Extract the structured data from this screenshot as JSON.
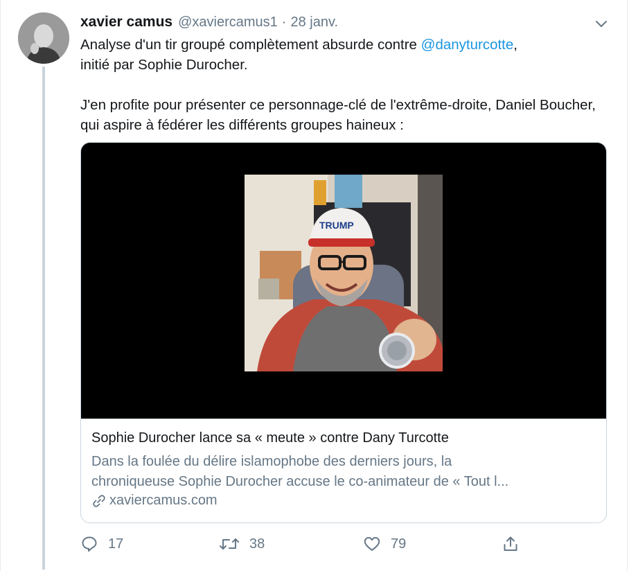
{
  "tweet": {
    "author_name": "xavier camus",
    "author_handle": "@xaviercamus1",
    "separator": "·",
    "date": "28 janv.",
    "text_line1_before": "Analyse d'un tir groupé complètement absurde contre ",
    "mention": "@danyturcotte",
    "text_line1_after": ",",
    "text_line2": "initié par Sophie Durocher.",
    "paragraph2": "J'en profite pour présenter ce personnage-clé de l'extrême-droite, Daniel Boucher, qui aspire à fédérer les différents groupes haineux :"
  },
  "card": {
    "title": "Sophie Durocher lance sa « meute » contre Dany Turcotte",
    "description_line1": "Dans la foulée du délire islamophobe des derniers jours, la",
    "description_line2": "chroniqueuse Sophie Durocher accuse le co-animateur de « Tout l...",
    "domain": "xaviercamus.com",
    "image_cap_text": "TRUMP"
  },
  "actions": {
    "reply_count": "17",
    "retweet_count": "38",
    "like_count": "79"
  },
  "icons": {
    "reply": "reply-icon",
    "retweet": "retweet-icon",
    "like": "heart-icon",
    "share": "share-icon",
    "caret": "chevron-down-icon",
    "link": "link-icon"
  },
  "colors": {
    "accent": "#1b95e0",
    "secondary_text": "#657786",
    "thread_line": "#c9d3db",
    "card_border": "#ccd6dd"
  }
}
